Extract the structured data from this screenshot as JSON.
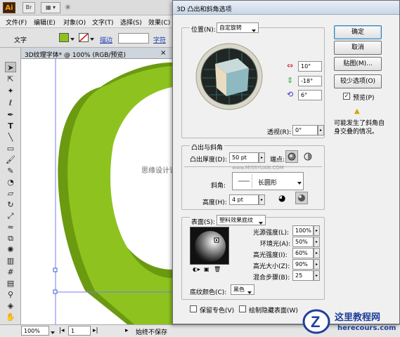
{
  "app": {
    "logo": "Ai",
    "toolbar_br": "Br",
    "view_mode": "▦ ▾",
    "star_icon": "star-icon"
  },
  "menu": [
    "文件(F)",
    "编辑(E)",
    "对象(O)",
    "文字(T)",
    "选择(S)",
    "效果(C)"
  ],
  "control": {
    "label": "文字",
    "fill_color": "#8dc21f",
    "stroke_label": "描边",
    "char_label": "字符"
  },
  "document": {
    "tab_title": "3D纹理字体* @ 100% (RGB/预览)",
    "close": "×",
    "shape_color_main": "#8ec31f",
    "shape_color_dark": "#6b9a11"
  },
  "status": {
    "zoom": "100%",
    "page": "1",
    "text": "始终不保存"
  },
  "watermark": {
    "text": "思缘设计论坛",
    "url": "www.MISSYUAN.COM"
  },
  "dialog": {
    "title": "3D 凸出和斜角选项",
    "position_label": "位置(N):",
    "position_value": "自定旋转",
    "rot_x": "10°",
    "rot_y": "-18°",
    "rot_z": "6°",
    "perspective_label": "透视(R):",
    "perspective_value": "0°",
    "extrude_section": "凸出与斜角",
    "extrude_depth_label": "凸出厚度(D):",
    "extrude_depth_value": "50 pt",
    "cap_label": "端点:",
    "bevel_label": "斜角:",
    "bevel_value": "长圆形",
    "height_label": "高度(H):",
    "height_value": "4 pt",
    "surface_label": "表面(S):",
    "surface_value": "塑料效果底纹",
    "light_intensity_label": "光源强度(L):",
    "light_intensity_value": "100%",
    "ambient_label": "环境光(A):",
    "ambient_value": "50%",
    "highlight_intensity_label": "高光强度(I):",
    "highlight_intensity_value": "60%",
    "highlight_size_label": "高光大小(Z):",
    "highlight_size_value": "90%",
    "blend_steps_label": "混合步骤(B):",
    "blend_steps_value": "25",
    "shading_color_label": "底纹颜色(C):",
    "shading_color_value": "黑色",
    "preserve_spot_label": "保留专色(V)",
    "draw_hidden_label": "绘制隐藏表面(W)",
    "ok": "确定",
    "cancel": "取消",
    "map": "贴图(M)...",
    "fewer_options": "较少选项(O)",
    "preview_label": "预览(P)",
    "preview_checked": true,
    "warning_text_1": "可能发生了斜角自",
    "warning_text_2": "身交叠的情况。",
    "cube_face_color": "#8fb9c0",
    "cube_side_color": "#e9dcc0"
  },
  "site_logo": {
    "name": "这里教程网",
    "url": "herecours.com",
    "color": "#1f3f9a"
  }
}
